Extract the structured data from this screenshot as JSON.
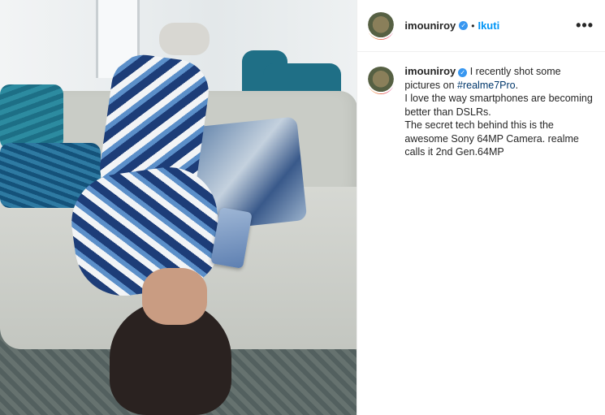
{
  "post": {
    "username": "imouniroy",
    "follow_label": "Ikuti",
    "separator": "•",
    "more_label": "•••",
    "caption": {
      "username": "imouniroy",
      "text_before": " I recently shot some pictures on ",
      "hashtag": "#realme7Pro",
      "text_after": ".",
      "lines": [
        "I love the way smartphones are becoming better than DSLRs.",
        "The secret tech behind this is the awesome Sony 64MP Camera. realme calls it 2nd Gen.64MP"
      ]
    }
  },
  "colors": {
    "link": "#0095f6",
    "verified": "#3897f0",
    "hashtag": "#00376b"
  },
  "icons": {
    "verified": "verified-badge-icon",
    "more": "more-options-icon"
  }
}
